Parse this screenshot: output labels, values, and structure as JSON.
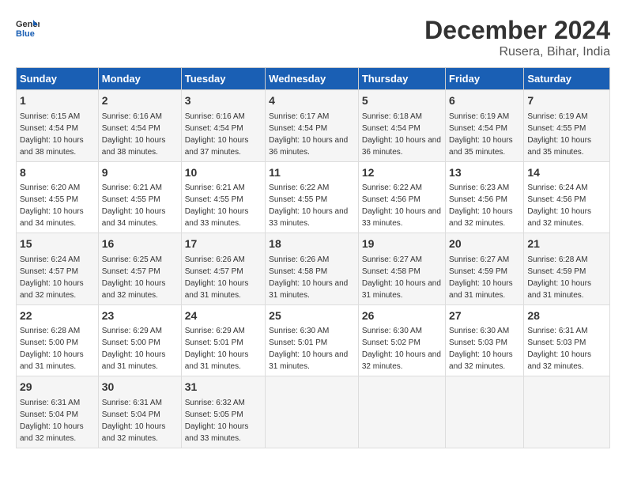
{
  "header": {
    "logo_line1": "General",
    "logo_line2": "Blue",
    "month_year": "December 2024",
    "location": "Rusera, Bihar, India"
  },
  "days_of_week": [
    "Sunday",
    "Monday",
    "Tuesday",
    "Wednesday",
    "Thursday",
    "Friday",
    "Saturday"
  ],
  "weeks": [
    [
      {
        "day": "1",
        "sunrise": "6:15 AM",
        "sunset": "4:54 PM",
        "daylight": "10 hours and 38 minutes."
      },
      {
        "day": "2",
        "sunrise": "6:16 AM",
        "sunset": "4:54 PM",
        "daylight": "10 hours and 38 minutes."
      },
      {
        "day": "3",
        "sunrise": "6:16 AM",
        "sunset": "4:54 PM",
        "daylight": "10 hours and 37 minutes."
      },
      {
        "day": "4",
        "sunrise": "6:17 AM",
        "sunset": "4:54 PM",
        "daylight": "10 hours and 36 minutes."
      },
      {
        "day": "5",
        "sunrise": "6:18 AM",
        "sunset": "4:54 PM",
        "daylight": "10 hours and 36 minutes."
      },
      {
        "day": "6",
        "sunrise": "6:19 AM",
        "sunset": "4:54 PM",
        "daylight": "10 hours and 35 minutes."
      },
      {
        "day": "7",
        "sunrise": "6:19 AM",
        "sunset": "4:55 PM",
        "daylight": "10 hours and 35 minutes."
      }
    ],
    [
      {
        "day": "8",
        "sunrise": "6:20 AM",
        "sunset": "4:55 PM",
        "daylight": "10 hours and 34 minutes."
      },
      {
        "day": "9",
        "sunrise": "6:21 AM",
        "sunset": "4:55 PM",
        "daylight": "10 hours and 34 minutes."
      },
      {
        "day": "10",
        "sunrise": "6:21 AM",
        "sunset": "4:55 PM",
        "daylight": "10 hours and 33 minutes."
      },
      {
        "day": "11",
        "sunrise": "6:22 AM",
        "sunset": "4:55 PM",
        "daylight": "10 hours and 33 minutes."
      },
      {
        "day": "12",
        "sunrise": "6:22 AM",
        "sunset": "4:56 PM",
        "daylight": "10 hours and 33 minutes."
      },
      {
        "day": "13",
        "sunrise": "6:23 AM",
        "sunset": "4:56 PM",
        "daylight": "10 hours and 32 minutes."
      },
      {
        "day": "14",
        "sunrise": "6:24 AM",
        "sunset": "4:56 PM",
        "daylight": "10 hours and 32 minutes."
      }
    ],
    [
      {
        "day": "15",
        "sunrise": "6:24 AM",
        "sunset": "4:57 PM",
        "daylight": "10 hours and 32 minutes."
      },
      {
        "day": "16",
        "sunrise": "6:25 AM",
        "sunset": "4:57 PM",
        "daylight": "10 hours and 32 minutes."
      },
      {
        "day": "17",
        "sunrise": "6:26 AM",
        "sunset": "4:57 PM",
        "daylight": "10 hours and 31 minutes."
      },
      {
        "day": "18",
        "sunrise": "6:26 AM",
        "sunset": "4:58 PM",
        "daylight": "10 hours and 31 minutes."
      },
      {
        "day": "19",
        "sunrise": "6:27 AM",
        "sunset": "4:58 PM",
        "daylight": "10 hours and 31 minutes."
      },
      {
        "day": "20",
        "sunrise": "6:27 AM",
        "sunset": "4:59 PM",
        "daylight": "10 hours and 31 minutes."
      },
      {
        "day": "21",
        "sunrise": "6:28 AM",
        "sunset": "4:59 PM",
        "daylight": "10 hours and 31 minutes."
      }
    ],
    [
      {
        "day": "22",
        "sunrise": "6:28 AM",
        "sunset": "5:00 PM",
        "daylight": "10 hours and 31 minutes."
      },
      {
        "day": "23",
        "sunrise": "6:29 AM",
        "sunset": "5:00 PM",
        "daylight": "10 hours and 31 minutes."
      },
      {
        "day": "24",
        "sunrise": "6:29 AM",
        "sunset": "5:01 PM",
        "daylight": "10 hours and 31 minutes."
      },
      {
        "day": "25",
        "sunrise": "6:30 AM",
        "sunset": "5:01 PM",
        "daylight": "10 hours and 31 minutes."
      },
      {
        "day": "26",
        "sunrise": "6:30 AM",
        "sunset": "5:02 PM",
        "daylight": "10 hours and 32 minutes."
      },
      {
        "day": "27",
        "sunrise": "6:30 AM",
        "sunset": "5:03 PM",
        "daylight": "10 hours and 32 minutes."
      },
      {
        "day": "28",
        "sunrise": "6:31 AM",
        "sunset": "5:03 PM",
        "daylight": "10 hours and 32 minutes."
      }
    ],
    [
      {
        "day": "29",
        "sunrise": "6:31 AM",
        "sunset": "5:04 PM",
        "daylight": "10 hours and 32 minutes."
      },
      {
        "day": "30",
        "sunrise": "6:31 AM",
        "sunset": "5:04 PM",
        "daylight": "10 hours and 32 minutes."
      },
      {
        "day": "31",
        "sunrise": "6:32 AM",
        "sunset": "5:05 PM",
        "daylight": "10 hours and 33 minutes."
      },
      null,
      null,
      null,
      null
    ]
  ]
}
